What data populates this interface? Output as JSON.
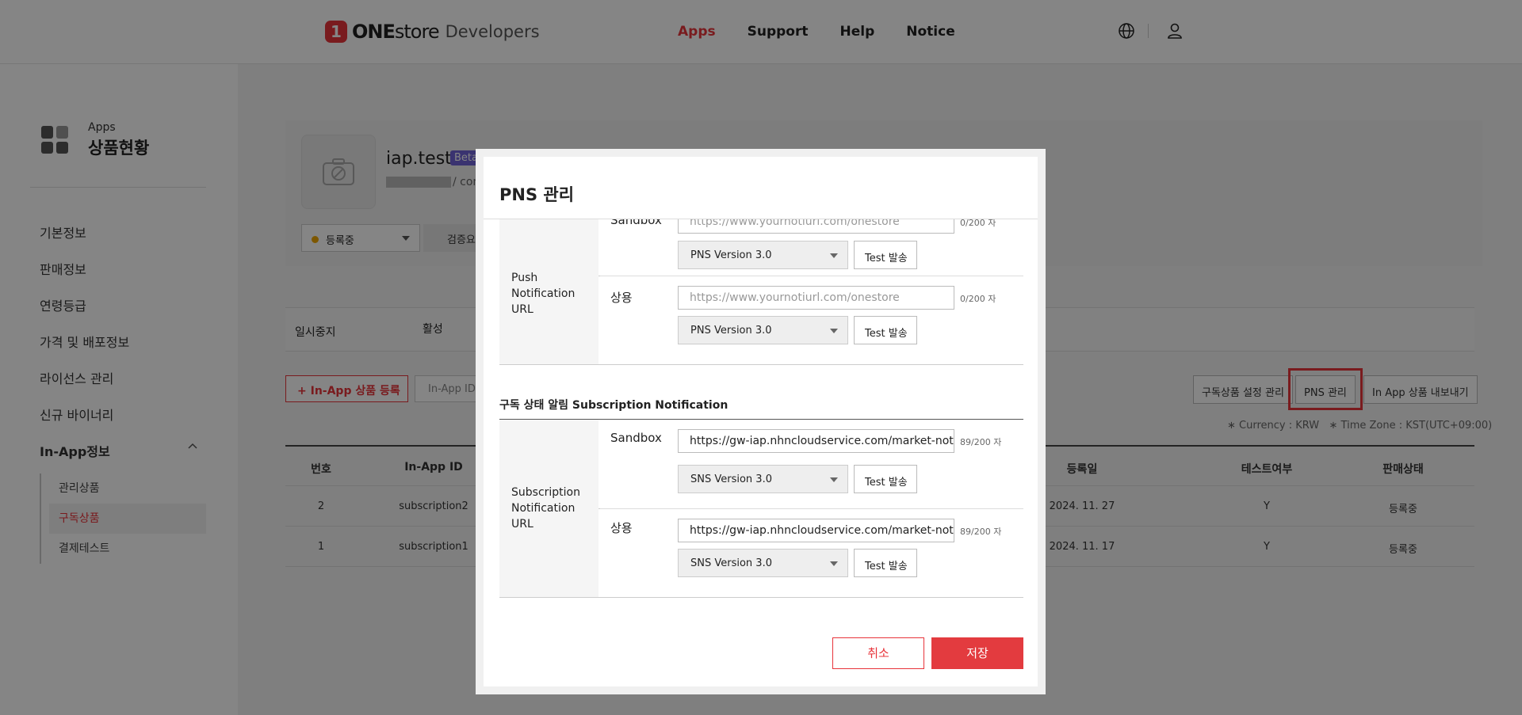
{
  "header": {
    "logo_badge": "1",
    "logo_one": "ONE",
    "logo_store": "store",
    "logo_dev": "Developers",
    "nav": [
      "Apps",
      "Support",
      "Help",
      "Notice"
    ],
    "active_nav": "Apps",
    "globe_icon": "globe-icon",
    "user_icon": "user-icon"
  },
  "sidebar": {
    "section_small": "Apps",
    "section_title": "상품현황",
    "items": [
      "기본정보",
      "판매정보",
      "연령등급",
      "가격 및 배포정보",
      "라이선스 관리",
      "신규 바이너리"
    ],
    "group_label": "In-App정보",
    "sub_items": [
      "관리상품",
      "구독상품",
      "결제테스트"
    ],
    "active_sub": "구독상품"
  },
  "app": {
    "name": "iap.test",
    "badge": "Beta",
    "package_suffix": "/ com",
    "status": "등록중",
    "verify_label": "검증요"
  },
  "tabs": [
    "일시중지",
    "활성"
  ],
  "toolbar": {
    "register": "+ In-App 상품 등록",
    "inapp_id": "In-App ID",
    "sub_settings": "구독상품 설정 관리",
    "pns": "PNS 관리",
    "export": "In App 상품 내보내기",
    "currency": "∗ Currency : KRW",
    "timezone": "∗ Time Zone : KST(UTC+09:00)"
  },
  "table": {
    "columns": [
      "번호",
      "In-App ID",
      "등록일",
      "테스트여부",
      "판매상태"
    ],
    "rows": [
      [
        "2",
        "subscription2",
        "2024. 11. 27",
        "Y",
        "등록중"
      ],
      [
        "1",
        "subscription1",
        "2024. 11. 17",
        "Y",
        "등록중"
      ]
    ]
  },
  "modal": {
    "title": "PNS 관리",
    "push": {
      "label": "Push\nNotification\nURL",
      "sandbox_label": "Sandbox",
      "sandbox_placeholder": "https://www.yournotiurl.com/onestore",
      "sandbox_count": "0/200 자",
      "sandbox_version": "PNS Version 3.0",
      "prod_label": "상용",
      "prod_placeholder": "https://www.yournotiurl.com/onestore",
      "prod_count": "0/200 자",
      "prod_version": "PNS Version 3.0"
    },
    "subscription_title": "구독 상태 알림 Subscription Notification",
    "sub": {
      "label": "Subscription\nNotification\nURL",
      "sandbox_label": "Sandbox",
      "sandbox_url": "https://gw-iap.nhncloudservice.com/market-notification",
      "sandbox_count": "89/200 자",
      "sandbox_version": "SNS Version 3.0",
      "prod_label": "상용",
      "prod_url": "https://gw-iap.nhncloudservice.com/market-notification",
      "prod_count": "89/200 자",
      "prod_version": "SNS Version 3.0"
    },
    "test_send": "Test 발송",
    "cancel": "취소",
    "save": "저장"
  },
  "colors": {
    "brand": "#e8343b",
    "beta": "#6f62d6",
    "status_dot": "#f0a800"
  }
}
